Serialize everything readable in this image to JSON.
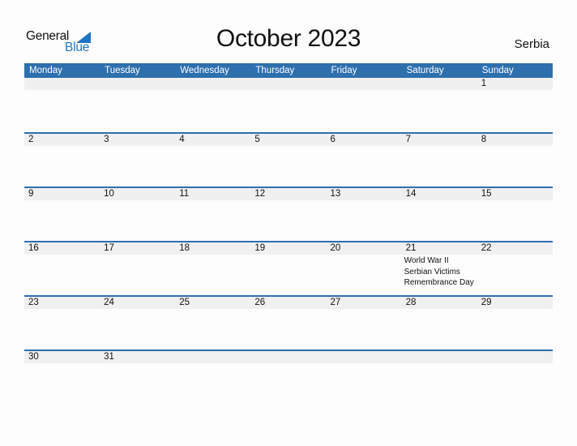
{
  "logo": {
    "word1": "General",
    "word2": "Blue"
  },
  "title": "October 2023",
  "country": "Serbia",
  "colors": {
    "header_bg": "#2e6fae",
    "logo_blue": "#1f75c4",
    "date_band": "#f0f0f0"
  },
  "weekdays": [
    "Monday",
    "Tuesday",
    "Wednesday",
    "Thursday",
    "Friday",
    "Saturday",
    "Sunday"
  ],
  "weeks": [
    {
      "days": [
        {
          "n": ""
        },
        {
          "n": ""
        },
        {
          "n": ""
        },
        {
          "n": ""
        },
        {
          "n": ""
        },
        {
          "n": ""
        },
        {
          "n": "1"
        }
      ]
    },
    {
      "days": [
        {
          "n": "2"
        },
        {
          "n": "3"
        },
        {
          "n": "4"
        },
        {
          "n": "5"
        },
        {
          "n": "6"
        },
        {
          "n": "7"
        },
        {
          "n": "8"
        }
      ]
    },
    {
      "days": [
        {
          "n": "9"
        },
        {
          "n": "10"
        },
        {
          "n": "11"
        },
        {
          "n": "12"
        },
        {
          "n": "13"
        },
        {
          "n": "14"
        },
        {
          "n": "15"
        }
      ]
    },
    {
      "days": [
        {
          "n": "16"
        },
        {
          "n": "17"
        },
        {
          "n": "18"
        },
        {
          "n": "19"
        },
        {
          "n": "20"
        },
        {
          "n": "21",
          "event": "World War II Serbian Victims Remembrance Day"
        },
        {
          "n": "22"
        }
      ]
    },
    {
      "days": [
        {
          "n": "23"
        },
        {
          "n": "24"
        },
        {
          "n": "25"
        },
        {
          "n": "26"
        },
        {
          "n": "27"
        },
        {
          "n": "28"
        },
        {
          "n": "29"
        }
      ]
    },
    {
      "days": [
        {
          "n": "30"
        },
        {
          "n": "31"
        },
        {
          "n": ""
        },
        {
          "n": ""
        },
        {
          "n": ""
        },
        {
          "n": ""
        },
        {
          "n": ""
        }
      ]
    }
  ]
}
